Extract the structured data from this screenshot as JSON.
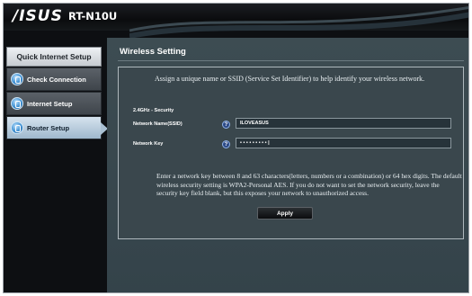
{
  "header": {
    "brand": "/ISUS",
    "model": "RT-N10U"
  },
  "sidebar": {
    "title": "Quick Internet Setup",
    "items": [
      {
        "label": "Check Connection",
        "icon": "connection-icon",
        "active": false
      },
      {
        "label": "Internet Setup",
        "icon": "globe-icon",
        "active": false
      },
      {
        "label": "Router Setup",
        "icon": "router-icon",
        "active": true
      }
    ]
  },
  "main": {
    "title": "Wireless Setting",
    "description": "Assign a unique name or SSID (Service Set Identifier) to help identify your wireless network.",
    "section_label": "2.4GHz - Security",
    "fields": {
      "ssid_label": "Network Name(SSID)",
      "ssid_value": "ILOVEASUS",
      "key_label": "Network Key",
      "key_value": "• • • • • • • • • |"
    },
    "note": "Enter a network key between 8 and 63 characters(letters, numbers or a combination) or 64 hex digits. The default wireless security setting is WPA2-Personal AES. If you do not want to set the network security, leave the security key field blank, but this exposes your network to unauthorized access.",
    "apply_label": "Apply"
  },
  "colors": {
    "accent": "#a9c0d3",
    "panel_bg": "#3a474d",
    "banner_bg": "#0b0c0e"
  }
}
